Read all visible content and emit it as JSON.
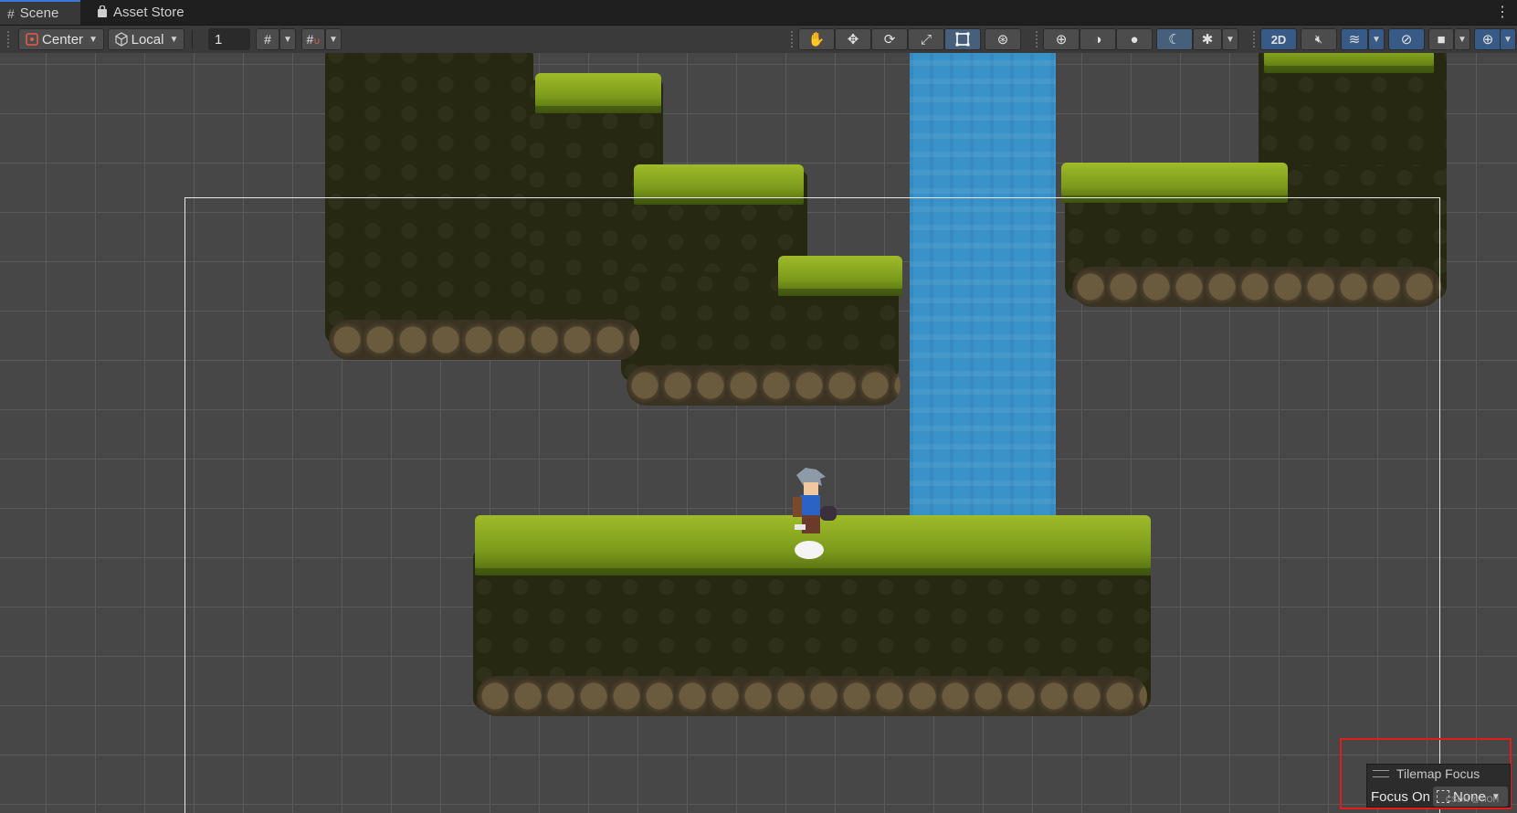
{
  "tabs": [
    {
      "label": "Scene",
      "icon": "grid-icon"
    },
    {
      "label": "Asset Store",
      "icon": "bag-icon"
    }
  ],
  "toolbar": {
    "pivot_mode": "Center",
    "pivot_rotation": "Local",
    "grid_increment": "1",
    "view_mode_2d": "2D"
  },
  "tilemap_focus": {
    "title": "Tilemap Focus",
    "label": "Focus On",
    "value": "None"
  },
  "watermark": "CSDN @TlOH",
  "colors": {
    "accent": "#3a79d8",
    "highlight_box": "#e21b1b",
    "water": "#3a93c8",
    "grass": "#8db424"
  }
}
